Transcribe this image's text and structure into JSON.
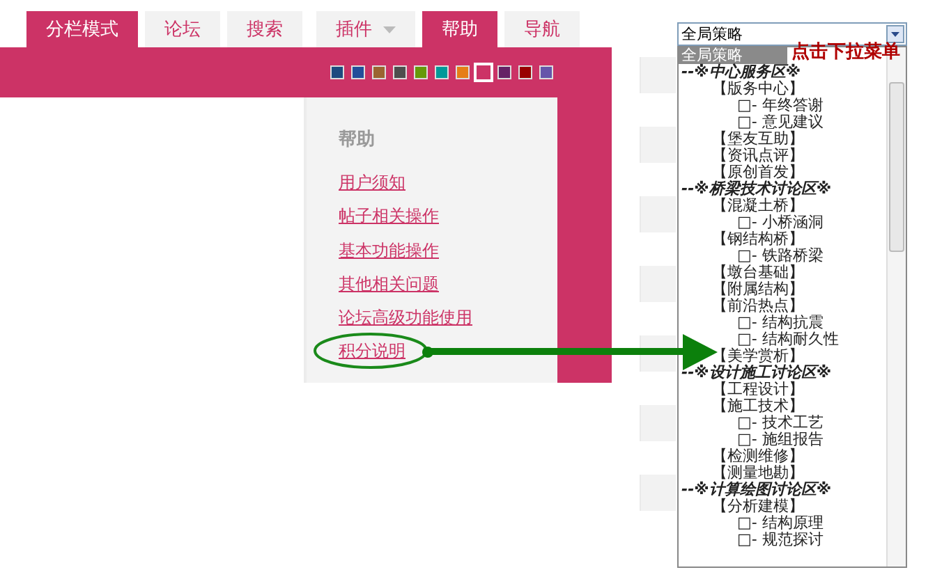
{
  "tabs": [
    {
      "label": "分栏模式",
      "selected": true,
      "dropdown": false
    },
    {
      "label": "论坛",
      "selected": false,
      "dropdown": false
    },
    {
      "label": "搜索",
      "selected": false,
      "dropdown": false
    },
    {
      "label": "插件",
      "selected": false,
      "dropdown": true
    },
    {
      "label": "帮助",
      "selected": true,
      "dropdown": false
    },
    {
      "label": "导航",
      "selected": false,
      "dropdown": false
    }
  ],
  "theme_swatches": [
    {
      "color": "#1e4a7f",
      "selected": false
    },
    {
      "color": "#234e9a",
      "selected": false
    },
    {
      "color": "#9b6431",
      "selected": false
    },
    {
      "color": "#4e4e4e",
      "selected": false
    },
    {
      "color": "#66990a",
      "selected": false
    },
    {
      "color": "#009999",
      "selected": false
    },
    {
      "color": "#e67e17",
      "selected": false
    },
    {
      "color": "#cc3366",
      "selected": true
    },
    {
      "color": "#662266",
      "selected": false
    },
    {
      "color": "#990000",
      "selected": false
    },
    {
      "color": "#6655aa",
      "selected": false
    }
  ],
  "help_panel": {
    "title": "帮助",
    "links": [
      "用户须知",
      "帖子相关操作",
      "基本功能操作",
      "其他相关问题",
      "论坛高级功能使用",
      "积分说明"
    ]
  },
  "dropdown": {
    "value": "全局策略",
    "options": [
      {
        "label": "全局策略",
        "kind": "option",
        "selected": true
      },
      {
        "label": "--※中心服务区※",
        "kind": "section",
        "selected": false,
        "children": [
          {
            "label": "【版务中心】",
            "kind": "forum",
            "selected": false,
            "children": [
              {
                "label": "□- 年终答谢",
                "kind": "sub",
                "selected": false
              },
              {
                "label": "□- 意见建议",
                "kind": "sub",
                "selected": false
              }
            ]
          },
          {
            "label": "【堡友互助】",
            "kind": "forum",
            "selected": false
          },
          {
            "label": "【资讯点评】",
            "kind": "forum",
            "selected": false
          },
          {
            "label": "【原创首发】",
            "kind": "forum",
            "selected": false
          }
        ]
      },
      {
        "label": "--※桥梁技术讨论区※",
        "kind": "section",
        "selected": false,
        "children": [
          {
            "label": "【混凝土桥】",
            "kind": "forum",
            "selected": false,
            "children": [
              {
                "label": "□- 小桥涵洞",
                "kind": "sub",
                "selected": false
              }
            ]
          },
          {
            "label": "【钢结构桥】",
            "kind": "forum",
            "selected": false,
            "children": [
              {
                "label": "□- 铁路桥梁",
                "kind": "sub",
                "selected": false
              }
            ]
          },
          {
            "label": "【墩台基础】",
            "kind": "forum",
            "selected": false
          },
          {
            "label": "【附属结构】",
            "kind": "forum",
            "selected": false
          },
          {
            "label": "【前沿热点】",
            "kind": "forum",
            "selected": false,
            "children": [
              {
                "label": "□- 结构抗震",
                "kind": "sub",
                "selected": false
              },
              {
                "label": "□- 结构耐久性",
                "kind": "sub",
                "selected": false
              }
            ]
          },
          {
            "label": "【美学赏析】",
            "kind": "forum",
            "selected": false
          }
        ]
      },
      {
        "label": "--※设计施工讨论区※",
        "kind": "section",
        "selected": false,
        "children": [
          {
            "label": "【工程设计】",
            "kind": "forum",
            "selected": false
          },
          {
            "label": "【施工技术】",
            "kind": "forum",
            "selected": false,
            "children": [
              {
                "label": "□- 技术工艺",
                "kind": "sub",
                "selected": false
              },
              {
                "label": "□- 施组报告",
                "kind": "sub",
                "selected": false
              }
            ]
          },
          {
            "label": "【检测维修】",
            "kind": "forum",
            "selected": false
          },
          {
            "label": "【测量地勘】",
            "kind": "forum",
            "selected": false
          }
        ]
      },
      {
        "label": "--※计算绘图讨论区※",
        "kind": "section",
        "selected": false,
        "children": [
          {
            "label": "【分析建模】",
            "kind": "forum",
            "selected": false,
            "children": [
              {
                "label": "□- 结构原理",
                "kind": "sub",
                "selected": false
              },
              {
                "label": "□- 规范探讨",
                "kind": "sub",
                "selected": false
              }
            ]
          }
        ]
      }
    ]
  },
  "annotation": {
    "text": "点击下拉菜单"
  }
}
